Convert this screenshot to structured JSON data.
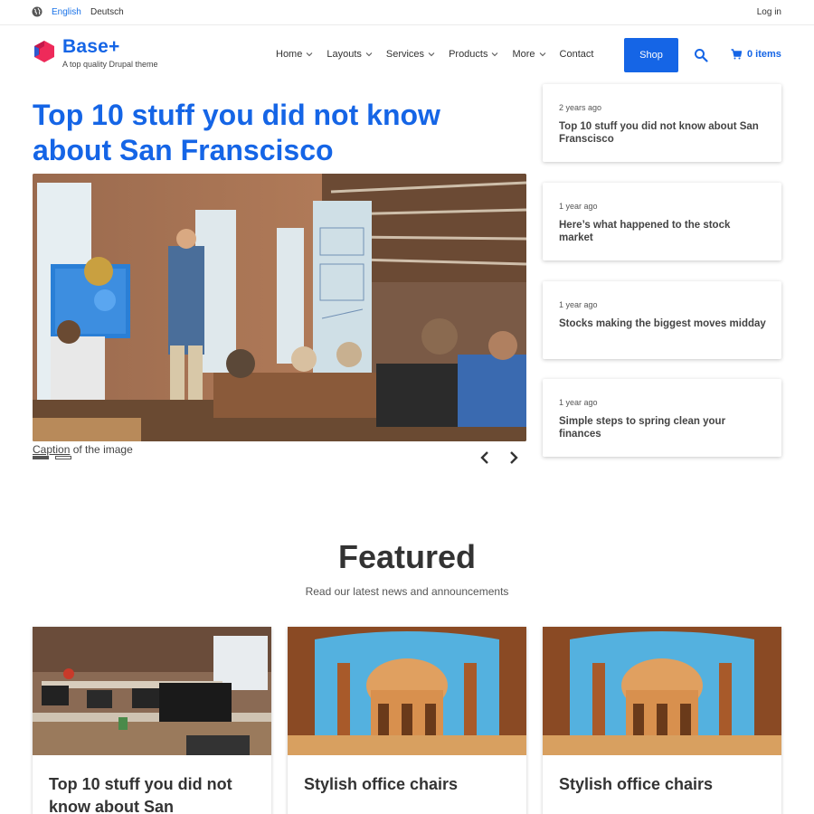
{
  "topbar": {
    "languages": [
      "English",
      "Deutsch"
    ],
    "login_label": "Log in"
  },
  "header": {
    "brand_name": "Base+",
    "brand_tagline": "A top quality Drupal theme",
    "nav": [
      {
        "label": "Home",
        "has_dropdown": true
      },
      {
        "label": "Layouts",
        "has_dropdown": true
      },
      {
        "label": "Services",
        "has_dropdown": true
      },
      {
        "label": "Products",
        "has_dropdown": true
      },
      {
        "label": "More",
        "has_dropdown": true
      },
      {
        "label": "Contact",
        "has_dropdown": false
      }
    ],
    "shop_label": "Shop",
    "cart_label": "0 items",
    "accent_color": "#1565e6",
    "logo_color": "#ee2a5a"
  },
  "hero": {
    "title": "Top 10 stuff you did not know about San Franscisco",
    "caption_link": "Caption",
    "caption_rest": " of the image",
    "slides_total": 2,
    "slide_active": 1
  },
  "side_articles": [
    {
      "time": "2 years ago",
      "title": "Top 10 stuff you did not know about San Franscisco"
    },
    {
      "time": "1 year ago",
      "title": "Here’s what happened to the stock market"
    },
    {
      "time": "1 year ago",
      "title": "Stocks making the biggest moves midday"
    },
    {
      "time": "1 year ago",
      "title": "Simple steps to spring clean your finances"
    }
  ],
  "featured": {
    "heading": "Featured",
    "subheading": "Read our latest news and announcements",
    "cards": [
      {
        "title": "Top 10 stuff you did not know about San",
        "image": "office-desks"
      },
      {
        "title": "Stylish office chairs",
        "image": "palace-arches"
      },
      {
        "title": "Stylish office chairs",
        "image": "palace-arches"
      }
    ]
  }
}
